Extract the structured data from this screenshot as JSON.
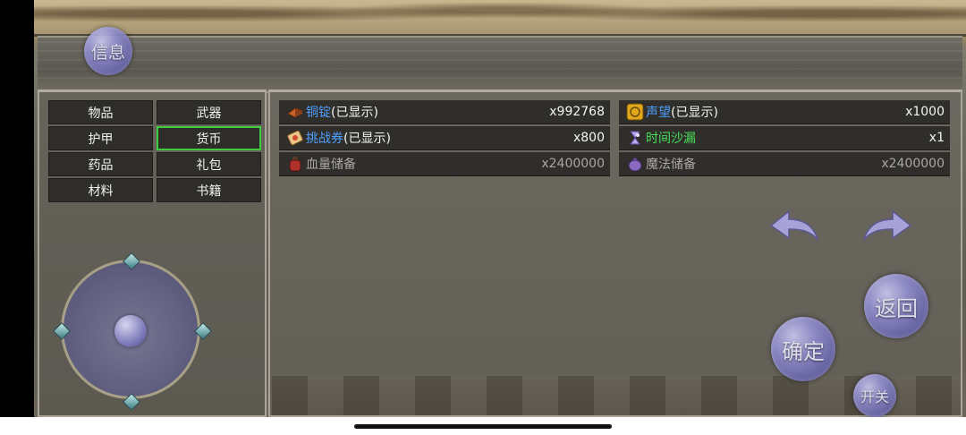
{
  "buttons": {
    "info": "信息",
    "confirm": "确定",
    "back": "返回",
    "toggle": "开关"
  },
  "categories": [
    {
      "label": "物品",
      "active": false
    },
    {
      "label": "武器",
      "active": false
    },
    {
      "label": "护甲",
      "active": false
    },
    {
      "label": "货币",
      "active": true
    },
    {
      "label": "药品",
      "active": false
    },
    {
      "label": "礼包",
      "active": false
    },
    {
      "label": "材料",
      "active": false
    },
    {
      "label": "书籍",
      "active": false
    }
  ],
  "items": [
    {
      "name": "铜锭",
      "suffix": "(已显示)",
      "qty": "x992768",
      "icon": "copper-ingot-icon"
    },
    {
      "name": "声望",
      "suffix": "(已显示)",
      "qty": "x1000",
      "icon": "prestige-icon"
    },
    {
      "name": "挑战券",
      "suffix": "(已显示)",
      "qty": "x800",
      "icon": "challenge-ticket-icon"
    },
    {
      "name": "时间沙漏",
      "suffix": "",
      "qty": "x1",
      "icon": "hourglass-icon"
    },
    {
      "name": "血量储备",
      "suffix": "",
      "qty": "x2400000",
      "icon": "health-potion-icon"
    },
    {
      "name": "魔法储备",
      "suffix": "",
      "qty": "x2400000",
      "icon": "mana-pouch-icon"
    }
  ],
  "colors": {
    "name_blue": "#4fa0ff",
    "name_green": "#48e05a",
    "active_border": "#3ecb3e",
    "button_purple": "#8f8ccc"
  }
}
